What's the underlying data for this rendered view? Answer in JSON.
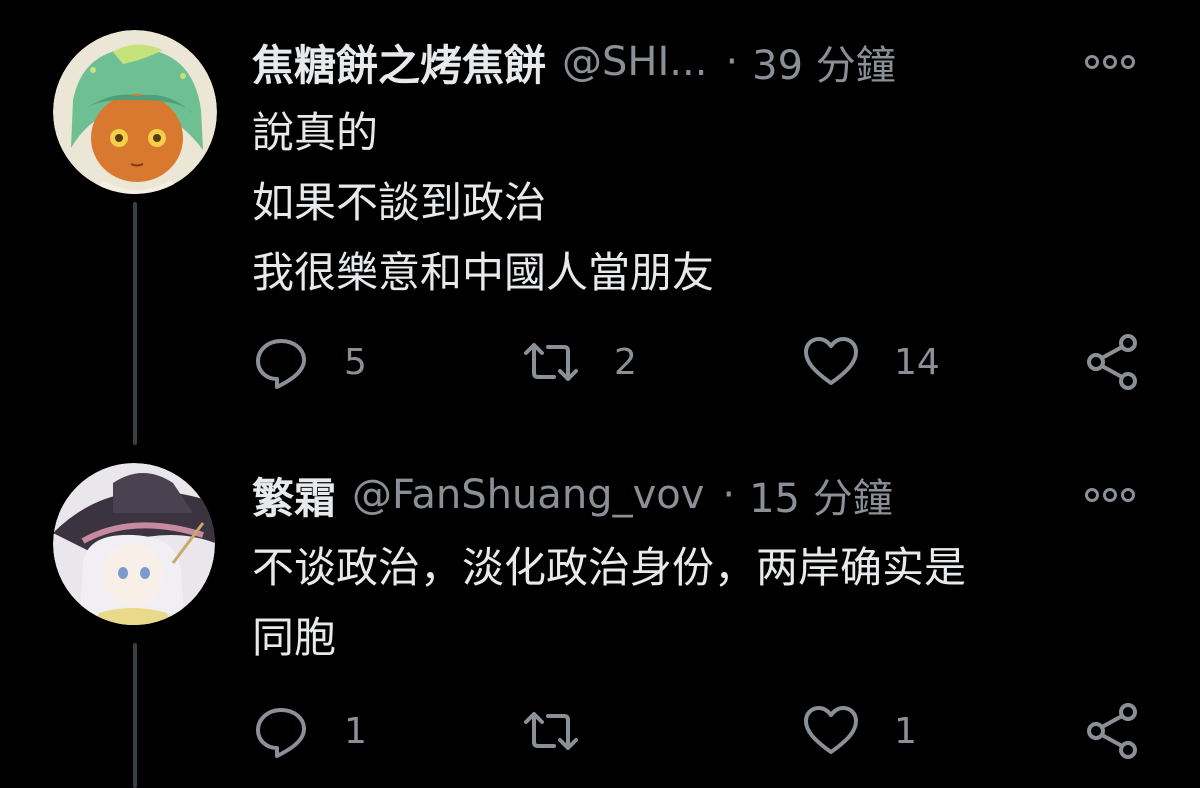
{
  "tweets": [
    {
      "display_name": "焦糖餅之烤焦餅",
      "handle": "@SHI...",
      "separator": "·",
      "time": "39 分鐘",
      "body_lines": [
        "說真的",
        "如果不談到政治",
        "我很樂意和中國人當朋友"
      ],
      "reply_count": "5",
      "retweet_count": "2",
      "like_count": "14",
      "avatar_icon": "avatar-anime-girl-green-hair",
      "more_icon": "more-options-icon"
    },
    {
      "display_name": "繁霜",
      "handle": "@FanShuang_vov",
      "separator": "·",
      "time": "15 分鐘",
      "body_lines": [
        "不谈政治，淡化政治身份，两岸确实是",
        "同胞"
      ],
      "reply_count": "1",
      "retweet_count": "",
      "like_count": "1",
      "avatar_icon": "avatar-anime-witch-girl",
      "more_icon": "more-options-icon"
    }
  ],
  "colors": {
    "background": "#000000",
    "primary_text": "#e7e9ea",
    "secondary_text": "#8b9096",
    "thread_line": "#3a3f44"
  }
}
